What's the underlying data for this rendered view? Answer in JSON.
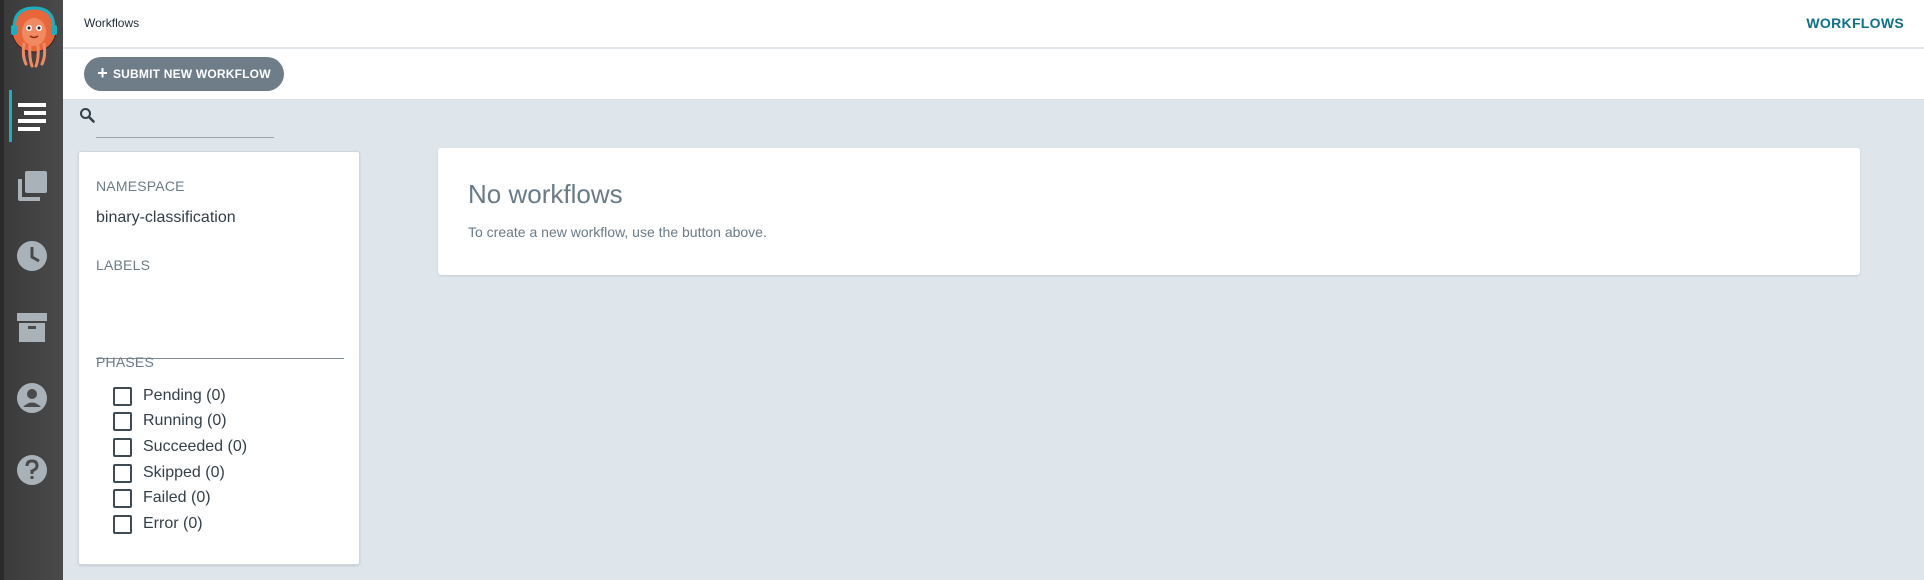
{
  "header": {
    "title": "Workflows",
    "right_title": "WORKFLOWS"
  },
  "toolbar": {
    "submit_label": "SUBMIT NEW WORKFLOW"
  },
  "search": {
    "value": "",
    "icon": "search-icon"
  },
  "nav": {
    "items": [
      {
        "icon": "timeline-icon",
        "active": true
      },
      {
        "icon": "copy-icon",
        "active": false
      },
      {
        "icon": "clock-icon",
        "active": false
      },
      {
        "icon": "archive-icon",
        "active": false
      },
      {
        "icon": "user-icon",
        "active": false
      },
      {
        "icon": "help-icon",
        "active": false
      }
    ]
  },
  "filters": {
    "namespace_label": "NAMESPACE",
    "namespace_value": "binary-classification",
    "labels_label": "LABELS",
    "labels_value": "",
    "phases_label": "PHASES",
    "phases": [
      {
        "label": "Pending (0)",
        "checked": false
      },
      {
        "label": "Running (0)",
        "checked": false
      },
      {
        "label": "Succeeded (0)",
        "checked": false
      },
      {
        "label": "Skipped (0)",
        "checked": false
      },
      {
        "label": "Failed (0)",
        "checked": false
      },
      {
        "label": "Error (0)",
        "checked": false
      }
    ]
  },
  "empty_state": {
    "heading": "No workflows",
    "message": "To create a new workflow, use the button above."
  },
  "colors": {
    "accent": "#0c7287",
    "nav_active": "#18b0c0",
    "button_bg": "#6f7d89",
    "page_bg": "#dee6ec"
  }
}
